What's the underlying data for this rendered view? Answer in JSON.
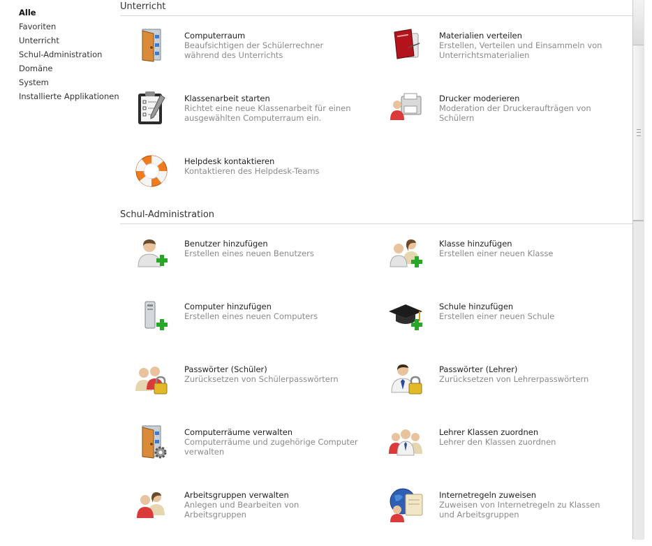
{
  "sidebar": {
    "categories": [
      {
        "label": "Alle"
      },
      {
        "label": "Favoriten"
      },
      {
        "label": "Unterricht"
      },
      {
        "label": "Schul-Administration"
      },
      {
        "label": "Domäne"
      },
      {
        "label": "System"
      },
      {
        "label": "Installierte Applikationen"
      }
    ],
    "active": "Alle"
  },
  "sections": [
    {
      "title": "Unterricht",
      "modules": [
        {
          "name": "Computerraum",
          "desc": "Beaufsichtigen der Schülerrechner während des Unterrichts",
          "icon": "door-computer-icon"
        },
        {
          "name": "Materialien verteilen",
          "desc": "Erstellen, Verteilen und Einsammeln von Unterrichtsmaterialien",
          "icon": "book-icon"
        },
        {
          "name": "Klassenarbeit starten",
          "desc": "Richtet eine neue Klassenarbeit für einen ausgewählten Computerraum ein.",
          "icon": "clipboard-icon"
        },
        {
          "name": "Drucker moderieren",
          "desc": "Moderation der Druckeraufträgen von Schülern",
          "icon": "printer-user-icon"
        },
        {
          "name": "Helpdesk kontaktieren",
          "desc": "Kontaktieren des Helpdesk-Teams",
          "icon": "lifebuoy-icon"
        }
      ]
    },
    {
      "title": "Schul-Administration",
      "modules": [
        {
          "name": "Benutzer hinzufügen",
          "desc": "Erstellen eines neuen Benutzers",
          "icon": "user-add-icon"
        },
        {
          "name": "Klasse hinzufügen",
          "desc": "Erstellen einer neuen Klasse",
          "icon": "group-add-icon"
        },
        {
          "name": "Computer hinzufügen",
          "desc": "Erstellen eines neuen Computers",
          "icon": "computer-add-icon"
        },
        {
          "name": "Schule hinzufügen",
          "desc": "Erstellen einer neuen Schule",
          "icon": "graduation-cap-add-icon"
        },
        {
          "name": "Passwörter (Schüler)",
          "desc": "Zurücksetzen von Schülerpasswörtern",
          "icon": "students-lock-icon"
        },
        {
          "name": "Passwörter (Lehrer)",
          "desc": "Zurücksetzen von Lehrerpasswörtern",
          "icon": "teacher-lock-icon"
        },
        {
          "name": "Computerräume verwalten",
          "desc": "Computerräume und zugehörige Computer verwalten",
          "icon": "door-gear-icon"
        },
        {
          "name": "Lehrer Klassen zuordnen",
          "desc": "Lehrer den Klassen zuordnen",
          "icon": "teachers-classes-icon"
        },
        {
          "name": "Arbeitsgruppen verwalten",
          "desc": "Anlegen und Bearbeiten von Arbeitsgruppen",
          "icon": "workgroup-icon"
        },
        {
          "name": "Internetregeln zuweisen",
          "desc": "Zuweisen von Internetregeln zu Klassen und Arbeitsgruppen",
          "icon": "globe-rules-icon"
        }
      ]
    }
  ]
}
